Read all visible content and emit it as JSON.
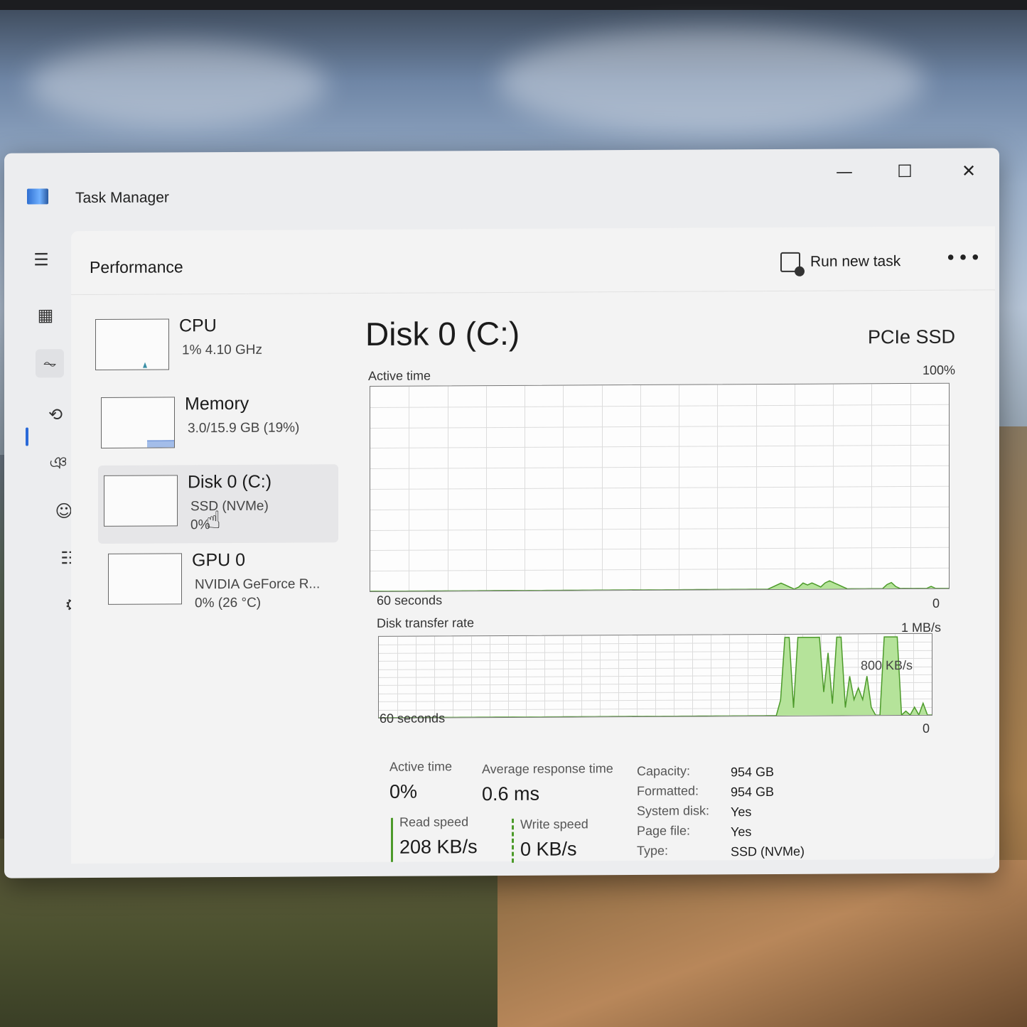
{
  "window": {
    "title": "Task Manager",
    "minimize": "—",
    "maximize": "☐",
    "close": "✕"
  },
  "nav": {
    "items": [
      {
        "name": "hamburger-menu-icon",
        "glyph": "☰"
      },
      {
        "name": "processes-icon",
        "glyph": "▦"
      },
      {
        "name": "performance-icon",
        "glyph": "⏦"
      },
      {
        "name": "app-history-icon",
        "glyph": "⟲"
      },
      {
        "name": "startup-apps-icon",
        "glyph": "ঞ"
      },
      {
        "name": "users-icon",
        "glyph": "☺"
      },
      {
        "name": "details-icon",
        "glyph": "☷"
      },
      {
        "name": "services-icon",
        "glyph": "⚙"
      }
    ],
    "settings_glyph": "⚙"
  },
  "header": {
    "title": "Performance",
    "run_task_label": "Run new task",
    "more_label": "•••"
  },
  "devices": [
    {
      "name": "CPU",
      "sub": "1%  4.10 GHz",
      "sub2": ""
    },
    {
      "name": "Memory",
      "sub": "3.0/15.9 GB (19%)",
      "sub2": ""
    },
    {
      "name": "Disk 0 (C:)",
      "sub": "SSD (NVMe)",
      "sub2": "0%"
    },
    {
      "name": "GPU 0",
      "sub": "NVIDIA GeForce R...",
      "sub2": "0%  (26 °C)"
    }
  ],
  "detail": {
    "title": "Disk 0 (C:)",
    "type": "PCIe SSD",
    "active_chart": {
      "label": "Active time",
      "max_label": "100%",
      "time_label": "60 seconds",
      "min_label": "0",
      "values_percent": [
        0,
        0,
        0,
        0,
        0,
        0,
        0,
        0,
        0,
        0,
        0,
        0,
        0,
        0,
        0,
        0,
        0,
        0,
        0,
        0,
        0,
        0,
        0,
        0,
        0,
        0,
        0,
        0,
        0,
        0,
        0,
        0,
        0,
        0,
        0,
        0,
        0,
        0,
        0,
        0,
        0,
        0,
        0,
        0,
        0,
        0,
        0,
        0,
        0,
        0,
        0,
        0,
        0,
        0,
        0,
        0,
        0,
        0,
        0,
        0,
        0,
        0,
        0,
        0,
        0,
        0,
        0,
        0,
        0,
        0,
        0,
        0,
        0,
        0,
        0,
        0,
        0,
        0,
        0,
        0,
        0,
        0,
        0,
        0,
        0,
        0,
        0,
        0,
        0,
        0,
        0,
        1,
        2,
        3,
        2,
        1,
        0,
        1,
        3,
        2,
        3,
        2,
        1,
        3,
        4,
        3,
        2,
        1,
        0,
        0,
        0,
        0,
        0,
        0,
        0,
        0,
        0,
        2,
        3,
        1,
        0,
        0,
        0,
        0,
        0,
        0,
        0,
        1,
        0,
        0,
        0,
        0
      ]
    },
    "transfer_chart": {
      "label": "Disk transfer rate",
      "max_label": "1 MB/s",
      "mid_label": "800 KB/s",
      "time_label": "60 seconds",
      "min_label": "0",
      "values_kbps": [
        0,
        0,
        0,
        0,
        0,
        0,
        0,
        0,
        0,
        0,
        0,
        0,
        0,
        0,
        0,
        0,
        0,
        0,
        0,
        0,
        0,
        0,
        0,
        0,
        0,
        0,
        0,
        0,
        0,
        0,
        0,
        0,
        0,
        0,
        0,
        0,
        0,
        0,
        0,
        0,
        0,
        0,
        0,
        0,
        0,
        0,
        0,
        0,
        0,
        0,
        0,
        0,
        0,
        0,
        0,
        0,
        0,
        0,
        0,
        0,
        0,
        0,
        0,
        0,
        0,
        0,
        0,
        0,
        0,
        0,
        0,
        0,
        0,
        0,
        0,
        0,
        0,
        0,
        0,
        0,
        0,
        0,
        0,
        0,
        0,
        0,
        0,
        0,
        0,
        0,
        0,
        0,
        0,
        200,
        1000,
        1000,
        100,
        1000,
        1000,
        1000,
        1000,
        1000,
        1000,
        300,
        800,
        150,
        1000,
        1000,
        100,
        500,
        200,
        350,
        200,
        500,
        100,
        0,
        0,
        1000,
        1000,
        1000,
        1000,
        0,
        50,
        0,
        100,
        0,
        150,
        0,
        0
      ]
    }
  },
  "stats": {
    "active_time_label": "Active time",
    "active_time_value": "0%",
    "avg_response_label": "Average response time",
    "avg_response_value": "0.6 ms",
    "read_label": "Read speed",
    "read_value": "208 KB/s",
    "write_label": "Write speed",
    "write_value": "0 KB/s"
  },
  "properties": [
    {
      "label": "Capacity:",
      "value": "954 GB"
    },
    {
      "label": "Formatted:",
      "value": "954 GB"
    },
    {
      "label": "System disk:",
      "value": "Yes"
    },
    {
      "label": "Page file:",
      "value": "Yes"
    },
    {
      "label": "Type:",
      "value": "SSD (NVMe)"
    }
  ],
  "colors": {
    "chart_fill": "#b5e39a",
    "chart_line": "#4c9a2a",
    "accent": "#2b6ad8"
  }
}
